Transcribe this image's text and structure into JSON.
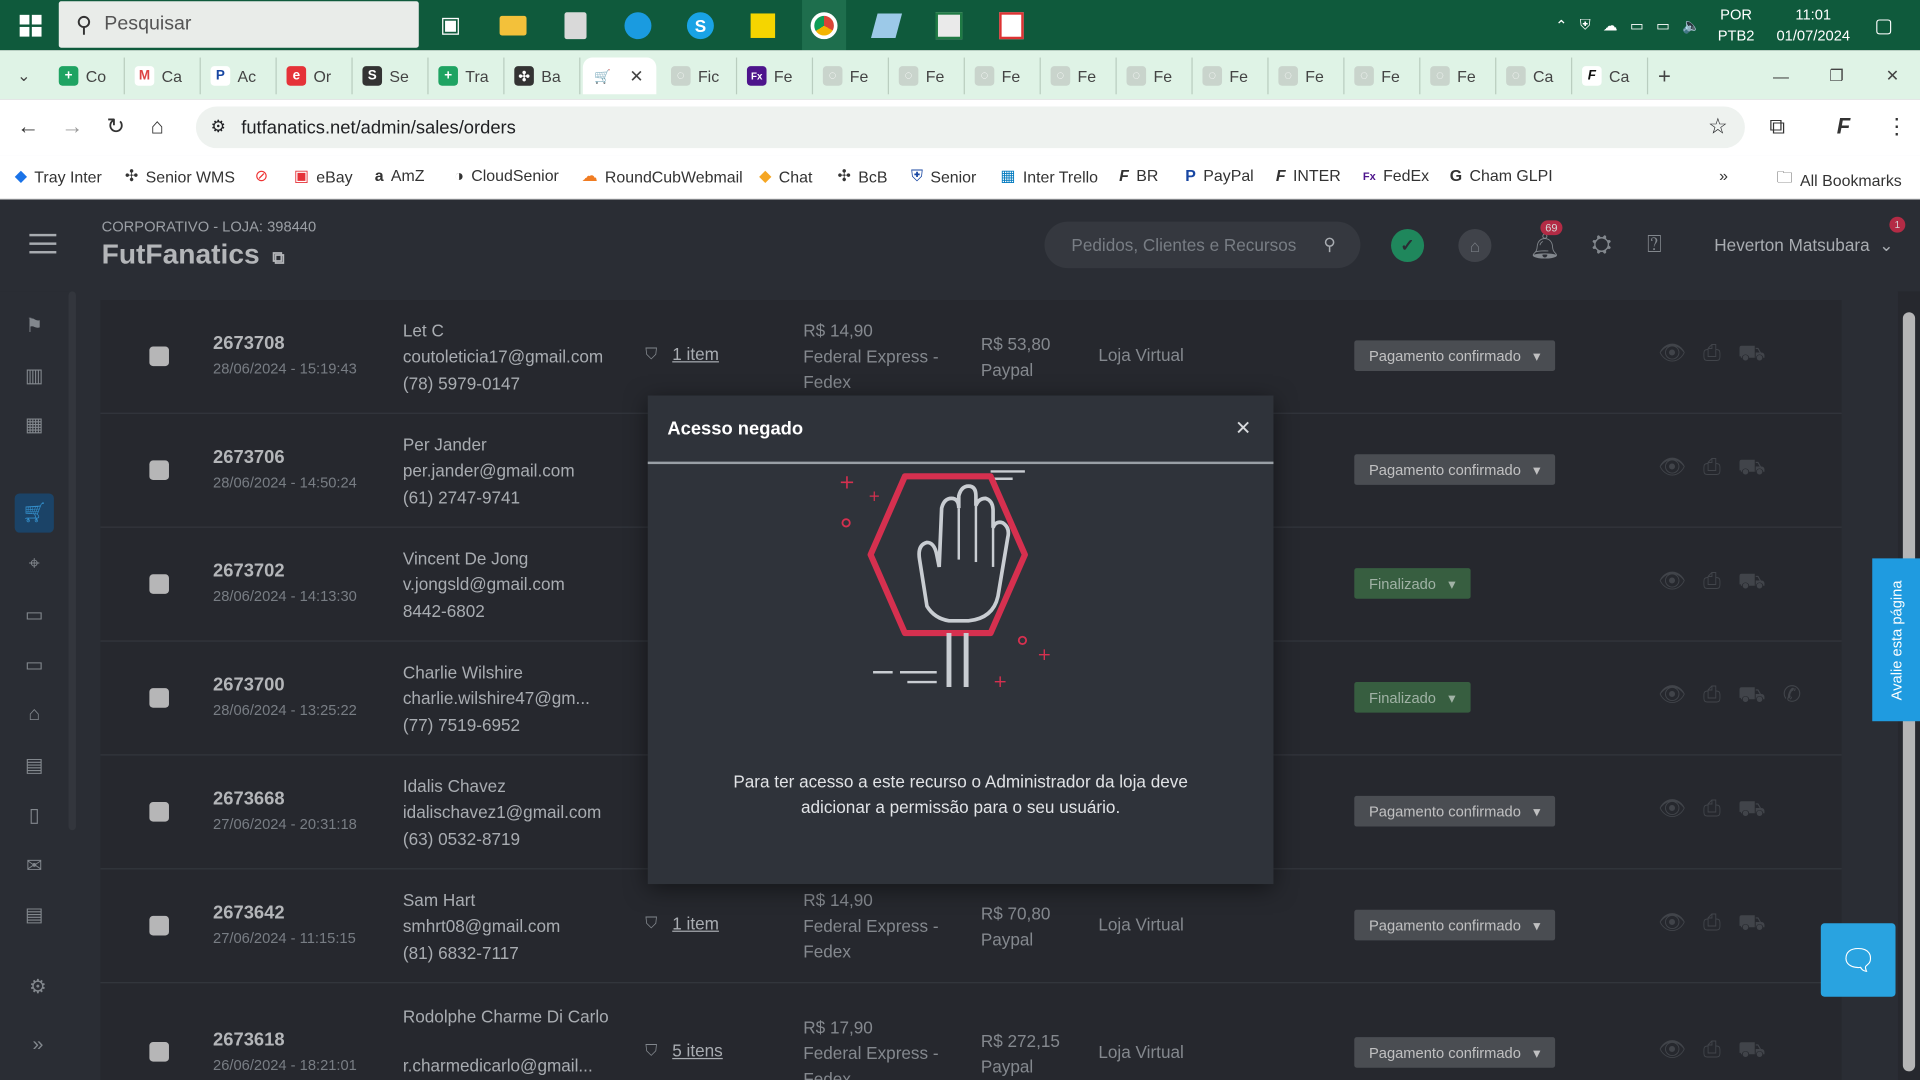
{
  "taskbar": {
    "search_placeholder": "Pesquisar",
    "lang": "POR",
    "layout": "PTB2",
    "time": "11:01",
    "date": "01/07/2024"
  },
  "tabs": [
    "Co",
    "Ca",
    "Ac",
    "Or",
    "Se",
    "Tra",
    "Ba",
    "",
    "Fic",
    "Fe",
    "Fe",
    "Fe",
    "Fe",
    "Fe",
    "Fe",
    "Fe",
    "Fe",
    "Fe",
    "Fe",
    "Ca"
  ],
  "browser": {
    "url": "futfanatics.net/admin/sales/orders"
  },
  "bookmarks": {
    "items": [
      "Tray Inter",
      "Senior WMS",
      "",
      "eBay",
      "AmZ",
      "CloudSenior",
      "RoundCubWebmail",
      "Chat",
      "BcB",
      "Senior",
      "Inter Trello",
      "BR",
      "PayPal",
      "INTER",
      "FedEx",
      "Cham GLPI"
    ],
    "all": "All Bookmarks"
  },
  "header": {
    "store_line": "CORPORATIVO - LOJA: 398440",
    "store_name": "FutFanatics",
    "search_placeholder": "Pedidos, Clientes e Recursos",
    "notif_count": "69",
    "user": "Heverton Matsubara",
    "user_badge": "1"
  },
  "orders": [
    {
      "id": "2673708",
      "date": "28/06/2024 - 15:19:43",
      "name": "Let C",
      "email": "coutoleticia17@gmail.com",
      "phone": "(78) 5979-0147",
      "items": "1 item",
      "ship_price": "R$ 14,90",
      "ship_method": "Federal Express - Fedex",
      "total": "R$ 53,80",
      "payment": "Paypal",
      "channel": "Loja Virtual",
      "status": "Pagamento confirmado"
    },
    {
      "id": "2673706",
      "date": "28/06/2024 - 14:50:24",
      "name": "Per Jander",
      "email": "per.jander@gmail.com",
      "phone": "(61) 2747-9741",
      "items": "",
      "ship_price": "",
      "ship_method": "",
      "total": "",
      "payment": "",
      "channel": "",
      "status": "Pagamento confirmado"
    },
    {
      "id": "2673702",
      "date": "28/06/2024 - 14:13:30",
      "name": "Vincent De Jong",
      "email": "v.jongsld@gmail.com",
      "phone": "8442-6802",
      "items": "",
      "ship_price": "",
      "ship_method": "",
      "total": "",
      "payment": "",
      "channel": "",
      "status": "Finalizado"
    },
    {
      "id": "2673700",
      "date": "28/06/2024 - 13:25:22",
      "name": "Charlie Wilshire",
      "email": "charlie.wilshire47@gm...",
      "phone": "(77) 7519-6952",
      "items": "",
      "ship_price": "",
      "ship_method": "",
      "total": "",
      "payment": "",
      "channel": "",
      "status": "Finalizado"
    },
    {
      "id": "2673668",
      "date": "27/06/2024 - 20:31:18",
      "name": "Idalis Chavez",
      "email": "idalischavez1@gmail.com",
      "phone": "(63) 0532-8719",
      "items": "",
      "ship_price": "",
      "ship_method": "",
      "total": "",
      "payment": "",
      "channel": "",
      "status": "Pagamento confirmado"
    },
    {
      "id": "2673642",
      "date": "27/06/2024 - 11:15:15",
      "name": "Sam Hart",
      "email": "smhrt08@gmail.com",
      "phone": "(81) 6832-7117",
      "items": "1 item",
      "ship_price": "R$ 14,90",
      "ship_method": "Federal Express - Fedex",
      "total": "R$ 70,80",
      "payment": "Paypal",
      "channel": "Loja Virtual",
      "status": "Pagamento confirmado"
    },
    {
      "id": "2673618",
      "date": "26/06/2024 - 18:21:01",
      "name": "Rodolphe Charme Di Carlo",
      "email": "r.charmedicarlo@gmail...",
      "phone": "",
      "items": "5 itens",
      "ship_price": "R$ 17,90",
      "ship_method": "Federal Express - Fedex",
      "total": "R$ 272,15",
      "payment": "Paypal",
      "channel": "Loja Virtual",
      "status": "Pagamento confirmado"
    }
  ],
  "modal": {
    "title": "Acesso negado",
    "message": "Para ter acesso a este recurso o Administrador da loja deve adicionar a permissão para o seu usuário."
  },
  "feedback_tab": "Avalie esta página",
  "colors": {
    "accent": "#1f9be0",
    "danger": "#d6304f",
    "success": "#3f6e48"
  }
}
